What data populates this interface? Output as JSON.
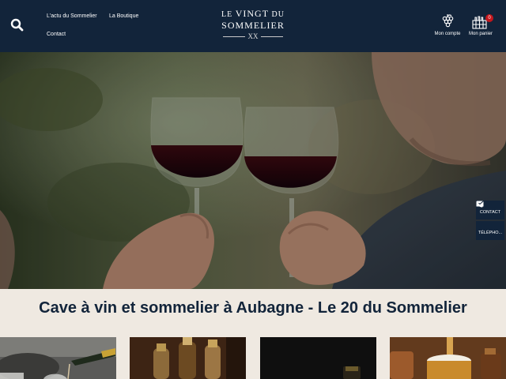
{
  "header": {
    "nav": {
      "actu": "L'actu du Sommelier",
      "boutique": "La Boutique",
      "contact": "Contact"
    },
    "logo": {
      "line1_le": "LE",
      "line1_vingt": "VINGT",
      "line1_du": "DU",
      "line2": "SOMMELIER",
      "numeral": "XX"
    },
    "account_label": "Mon compte",
    "cart_label": "Mon panier",
    "cart_count": "0"
  },
  "side_tabs": {
    "contact": "CONTACT",
    "phone": "TÉLÉPHO..."
  },
  "main": {
    "headline": "Cave à vin et sommelier à Aubagne - Le 20 du Sommelier"
  },
  "colors": {
    "navy": "#12243a",
    "cream": "#efe9e1",
    "badge_red": "#c4161c"
  },
  "icons": [
    "search-icon",
    "grape-icon",
    "wine-crate-icon",
    "envelope-icon",
    "phone-icon"
  ]
}
